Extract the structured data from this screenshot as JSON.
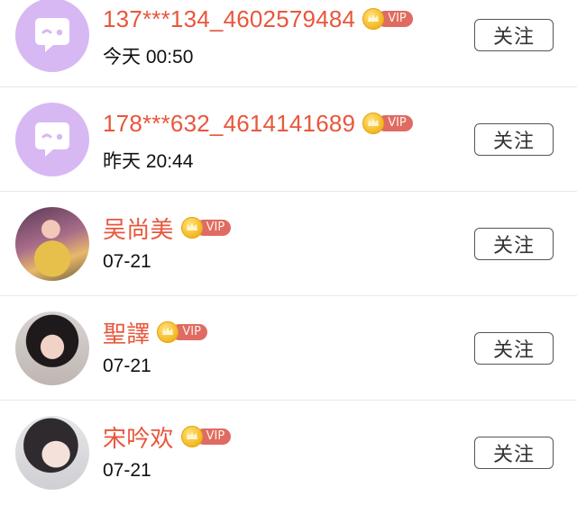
{
  "colors": {
    "name": "#e8573c",
    "vip_tag": "#df6b63",
    "default_avatar": "#d7b8f3"
  },
  "follow_label": "关注",
  "vip_label": "VIP",
  "users": [
    {
      "name": "137***134_4602579484",
      "time": "今天 00:50",
      "avatar": "default-chat-avatar"
    },
    {
      "name": "178***632_4614141689",
      "time": "昨天 20:44",
      "avatar": "default-chat-avatar"
    },
    {
      "name": "吴尚美",
      "time": "07-21",
      "avatar": "photo"
    },
    {
      "name": "聖譯",
      "time": "07-21",
      "avatar": "photo"
    },
    {
      "name": "宋吟欢",
      "time": "07-21",
      "avatar": "photo"
    }
  ]
}
